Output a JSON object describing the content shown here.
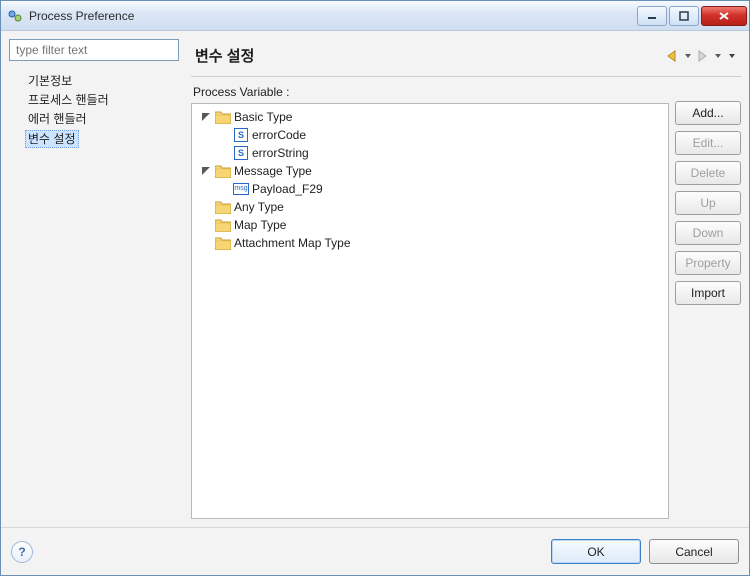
{
  "titlebar": {
    "title": "Process Preference"
  },
  "left": {
    "filter_placeholder": "type filter text",
    "items": [
      "기본정보",
      "프로세스 핸들러",
      "에러 핸들러",
      "변수 설정"
    ],
    "selected_index": 3
  },
  "right": {
    "title": "변수 설정",
    "pv_label": "Process Variable :",
    "buttons": {
      "add": "Add...",
      "edit": "Edit...",
      "delete": "Delete",
      "up": "Up",
      "down": "Down",
      "property": "Property",
      "import": "Import"
    }
  },
  "tree": [
    {
      "level": 0,
      "expanded": true,
      "icon": "folder",
      "label": "Basic Type"
    },
    {
      "level": 1,
      "expanded": null,
      "icon": "s",
      "label": "errorCode"
    },
    {
      "level": 1,
      "expanded": null,
      "icon": "s",
      "label": "errorString"
    },
    {
      "level": 0,
      "expanded": true,
      "icon": "folder",
      "label": "Message Type"
    },
    {
      "level": 1,
      "expanded": null,
      "icon": "msg",
      "label": "Payload_F29"
    },
    {
      "level": 0,
      "expanded": false,
      "icon": "folder",
      "label": "Any Type"
    },
    {
      "level": 0,
      "expanded": false,
      "icon": "folder",
      "label": "Map Type"
    },
    {
      "level": 0,
      "expanded": false,
      "icon": "folder",
      "label": "Attachment Map Type"
    }
  ],
  "footer": {
    "ok": "OK",
    "cancel": "Cancel"
  }
}
